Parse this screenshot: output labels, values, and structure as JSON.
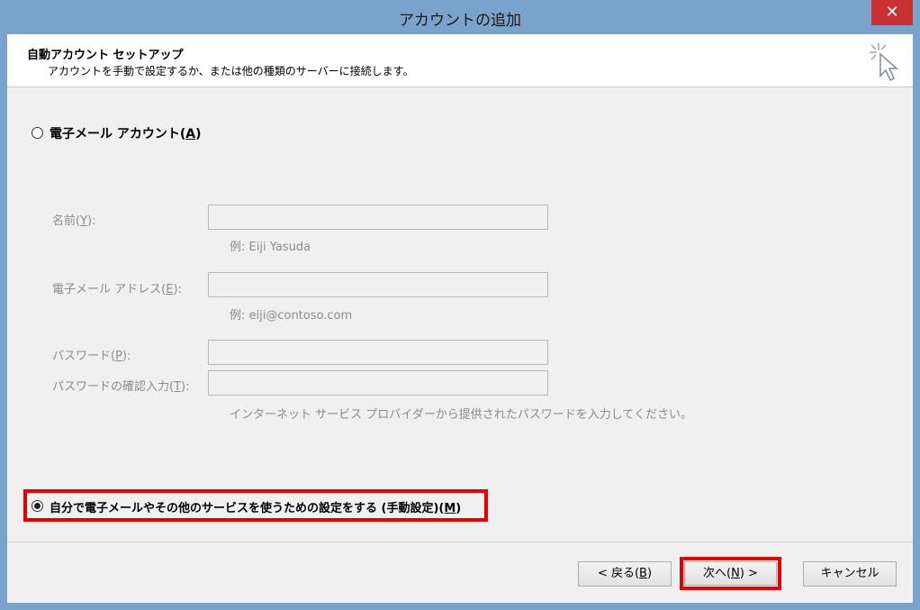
{
  "window": {
    "title": "アカウントの追加",
    "close_glyph": "✕"
  },
  "header": {
    "title": "自動アカウント セットアップ",
    "subtitle": "アカウントを手動で設定するか、または他の種類のサーバーに接続します。"
  },
  "email_account": {
    "label_prefix": "電子メール アカウント(",
    "accesskey": "A",
    "label_suffix": ")",
    "selected": false
  },
  "fields": {
    "name": {
      "label_prefix": "名前(",
      "accesskey": "Y",
      "label_suffix": "):",
      "value": "",
      "hint": "例: Eiji Yasuda"
    },
    "email": {
      "label_prefix": "電子メール アドレス(",
      "accesskey": "E",
      "label_suffix": "):",
      "value": "",
      "hint": "例: eiji@contoso.com"
    },
    "password": {
      "label_prefix": "パスワード(",
      "accesskey": "P",
      "label_suffix": "):",
      "value": ""
    },
    "password_confirm": {
      "label_prefix": "パスワードの確認入力(",
      "accesskey": "T",
      "label_suffix": "):",
      "value": ""
    },
    "password_hint": "インターネット サービス プロバイダーから提供されたパスワードを入力してください。"
  },
  "manual_setup": {
    "label_prefix": "自分で電子メールやその他のサービスを使うための設定をする (手動設定)(",
    "accesskey": "M",
    "label_suffix": ")",
    "selected": true
  },
  "buttons": {
    "back": {
      "prefix": "< 戻る(",
      "accesskey": "B",
      "suffix": ")"
    },
    "next": {
      "prefix": "次へ(",
      "accesskey": "N",
      "suffix": ") >"
    },
    "cancel": "キャンセル"
  },
  "colors": {
    "titlebar": "#7aa3cb",
    "highlight": "#e40000",
    "close": "#c7312f"
  }
}
